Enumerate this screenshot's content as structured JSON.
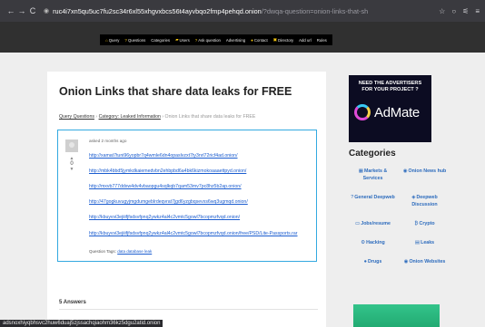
{
  "browser": {
    "nav_buttons": [
      "←",
      "→",
      "C"
    ],
    "url_host": "ruc4i7xn5qu5uc7fu2sc34r6xl55xhgvxbcs56t4ayvbqo2fmp4pehqd.onion",
    "url_path": "/?dwqa-question=onion-links-that-sh",
    "right_icons": [
      "☆",
      "○",
      "⚟",
      "≡"
    ]
  },
  "site_menu": [
    {
      "icon": "home-icon",
      "glyph": "⌂",
      "label": "Query"
    },
    {
      "icon": "question-icon",
      "glyph": "?",
      "label": "Questions"
    },
    {
      "icon": "",
      "glyph": "",
      "label": "Categories"
    },
    {
      "icon": "users-icon",
      "glyph": "▰",
      "label": "Users"
    },
    {
      "icon": "question-icon",
      "glyph": "?",
      "label": "Ask question"
    },
    {
      "icon": "",
      "glyph": "",
      "label": "Advertising"
    },
    {
      "icon": "comment-icon",
      "glyph": "●",
      "label": "Contact"
    },
    {
      "icon": "directory-icon",
      "glyph": "▣",
      "label": "Directory"
    },
    {
      "icon": "",
      "glyph": "",
      "label": "Add url"
    },
    {
      "icon": "",
      "glyph": "",
      "label": "Rules"
    }
  ],
  "question": {
    "title": "Onion Links that share data leaks for FREE",
    "breadcrumb_home": "Query Questions",
    "breadcrumb_sep1": " › ",
    "breadcrumb_category": "Category: Leaked Information",
    "breadcrumb_sep2": " › ",
    "breadcrumb_current": "Onion Links that share data leaks for FREE",
    "asked": "asked 2 months ago",
    "vote_count": "0",
    "links": [
      "http://xamat7tuni96yopbr7q4wmle6dn4opaslvzxt7ty3nrl72ricf4ad.onion/",
      "http://mbk4bbd5jymkdkaiemedvbn2ehbpbd6a4bk6kizmokoaaaettpyd.onion/",
      "http://mxvb777ddxw4dv4vbaopgu4sqlkqb7qam53mv7pc8hz5b2ap.onion/",
      "http://47gogkuvugyjmgdumgeblrdeqvrat7jgd6yzgbqsevxs6wq3ugmqd.onion/",
      "http://kbuyvvi3ejiiifjfsdsvfpnq2ywkz4al4c2vmtc5gowl7bcopmzfvqd.onion/",
      "http://kbuyvvi3ejiiifjfsdsvfpnq2ywkz4al4c2vmtc5gowl7bcopmzfvqd.onion/free/PSD/Lite-Passports.rar"
    ],
    "tags_label": "Question Tags:",
    "tags": "data database leak",
    "answers_count": "5 Answers"
  },
  "sidebar": {
    "ad_line1": "NEED THE ADVERTISERS",
    "ad_line2": "FOR YOUR PROJECT ?",
    "ad_brand": "AdMate",
    "categories_title": "Categories",
    "categories": [
      {
        "icon": "chart-icon",
        "glyph": "▦",
        "label": "Markets & Services"
      },
      {
        "icon": "onion-icon",
        "glyph": "◉",
        "label": "Onion News hub"
      },
      {
        "icon": "question-icon",
        "glyph": "?",
        "label": "General Deepweb"
      },
      {
        "icon": "deepweb-icon",
        "glyph": "◈",
        "label": "Deepweb Discussion"
      },
      {
        "icon": "jobs-icon",
        "glyph": "▭",
        "label": "Jobs/resume"
      },
      {
        "icon": "crypto-icon",
        "glyph": "₿",
        "label": "Crypto"
      },
      {
        "icon": "hacking-icon",
        "glyph": "⚙",
        "label": "Hacking"
      },
      {
        "icon": "leaks-icon",
        "glyph": "▤",
        "label": "Leaks"
      },
      {
        "icon": "drugs-icon",
        "glyph": "●",
        "label": "Drugs"
      },
      {
        "icon": "onion-icon",
        "glyph": "◉",
        "label": "Onion Websites"
      }
    ]
  },
  "status_bar": "adsnoxhiyqbhsvc2huw6duaj5zjssachqiaohm36kz5dgu2atid.onion"
}
